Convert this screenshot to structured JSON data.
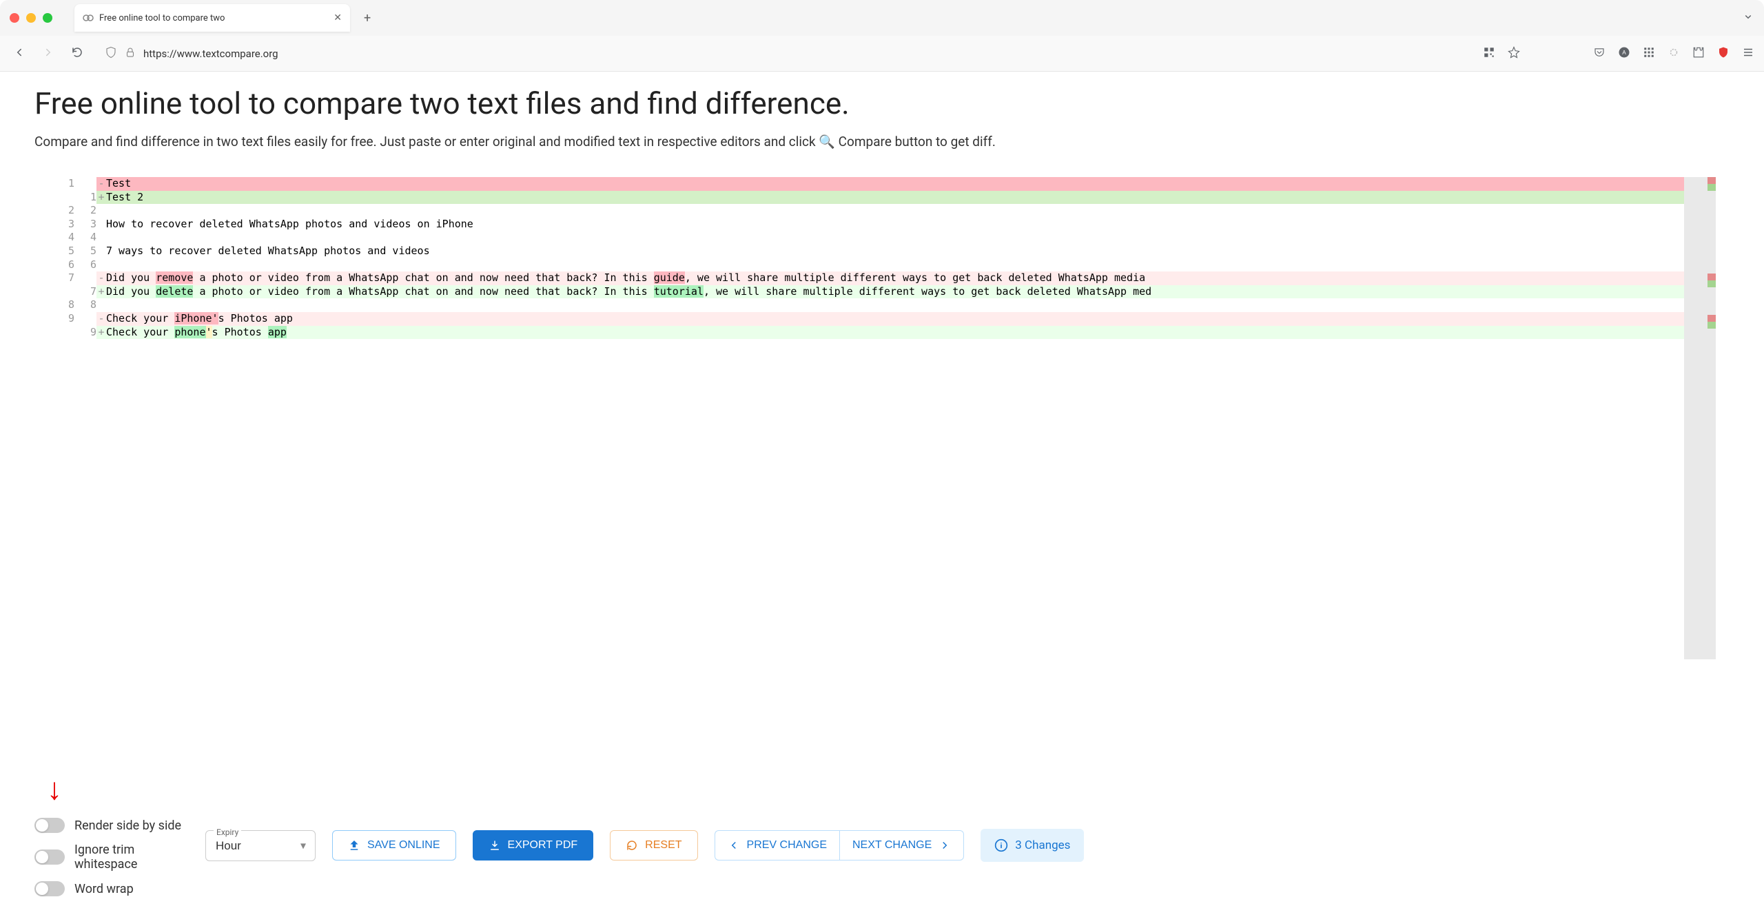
{
  "browser": {
    "tab_title": "Free online tool to compare two",
    "url_display": "https://www.textcompare.org",
    "url_prefix": "https://www."
  },
  "page": {
    "title": "Free online tool to compare two text files and find difference.",
    "subtitle_pre": "Compare and find difference in two text files easily for free. Just paste or enter original and modified text in respective editors and click ",
    "subtitle_post": " Compare button to get diff."
  },
  "diff": {
    "rows": [
      {
        "l": "1",
        "r": "",
        "sign": "-",
        "type": "del-dark",
        "segs": [
          [
            "",
            "Test"
          ]
        ]
      },
      {
        "l": "",
        "r": "1",
        "sign": "+",
        "type": "ins-dark",
        "segs": [
          [
            "",
            "Test 2"
          ]
        ]
      },
      {
        "l": "2",
        "r": "2",
        "sign": "",
        "type": "ctx",
        "segs": [
          [
            "",
            ""
          ]
        ]
      },
      {
        "l": "3",
        "r": "3",
        "sign": "",
        "type": "ctx",
        "segs": [
          [
            "",
            "How to recover deleted WhatsApp photos and videos on iPhone"
          ]
        ]
      },
      {
        "l": "4",
        "r": "4",
        "sign": "",
        "type": "ctx",
        "segs": [
          [
            "",
            ""
          ]
        ]
      },
      {
        "l": "5",
        "r": "5",
        "sign": "",
        "type": "ctx",
        "segs": [
          [
            "",
            "7 ways to recover deleted WhatsApp photos and videos"
          ]
        ]
      },
      {
        "l": "6",
        "r": "6",
        "sign": "",
        "type": "ctx",
        "segs": [
          [
            "",
            ""
          ]
        ]
      },
      {
        "l": "7",
        "r": "",
        "sign": "-",
        "type": "del",
        "segs": [
          [
            "",
            "Did you "
          ],
          [
            "del",
            "remove"
          ],
          [
            "",
            " a photo or video from a WhatsApp chat on and now need that back? In this "
          ],
          [
            "del",
            "guide"
          ],
          [
            "",
            ", we will share multiple different ways to get back deleted WhatsApp media "
          ]
        ]
      },
      {
        "l": "",
        "r": "7",
        "sign": "+",
        "type": "ins",
        "segs": [
          [
            "",
            "Did you "
          ],
          [
            "ins",
            "delete"
          ],
          [
            "",
            " a photo or video from a WhatsApp chat on and now need that back? In this "
          ],
          [
            "ins",
            "tutorial"
          ],
          [
            "",
            ", we will share multiple different ways to get back deleted WhatsApp med"
          ]
        ]
      },
      {
        "l": "8",
        "r": "8",
        "sign": "",
        "type": "ctx",
        "segs": [
          [
            "",
            ""
          ]
        ]
      },
      {
        "l": "9",
        "r": "",
        "sign": "-",
        "type": "del",
        "segs": [
          [
            "",
            "Check your "
          ],
          [
            "del",
            "iPhone'"
          ],
          [
            "",
            "s Photos app"
          ]
        ]
      },
      {
        "l": "",
        "r": "9",
        "sign": "+",
        "type": "ins",
        "segs": [
          [
            "",
            "Check your "
          ],
          [
            "ins",
            "phone"
          ],
          [
            "chg",
            "'"
          ],
          [
            "",
            "s Photos "
          ],
          [
            "ins",
            "app"
          ]
        ]
      }
    ]
  },
  "controls": {
    "toggles": {
      "side_by_side": "Render side by side",
      "ignore_trim": "Ignore trim whitespace",
      "word_wrap": "Word wrap"
    },
    "expiry_label": "Expiry",
    "expiry_value": "Hour",
    "save": "SAVE ONLINE",
    "export": "EXPORT PDF",
    "reset": "RESET",
    "prev": "PREV CHANGE",
    "next": "NEXT CHANGE",
    "changes": "3 Changes"
  }
}
